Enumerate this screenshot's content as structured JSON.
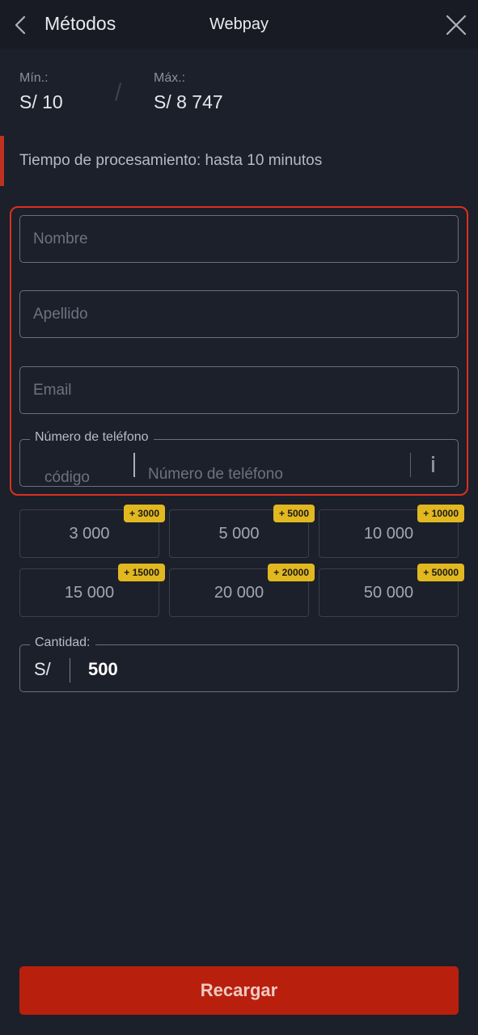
{
  "header": {
    "back_label": "Métodos",
    "title": "Webpay"
  },
  "limits": {
    "min_label": "Mín.:",
    "min_value": "S/ 10",
    "separator": "/",
    "max_label": "Máx.:",
    "max_value": "S/ 8 747"
  },
  "processing_text": "Tiempo de procesamiento: hasta 10 minutos",
  "form": {
    "first_name_placeholder": "Nombre",
    "last_name_placeholder": "Apellido",
    "email_placeholder": "Email",
    "phone_legend": "Número de teléfono",
    "phone_code_placeholder": "código",
    "phone_number_placeholder": "Número de teléfono"
  },
  "amount_options": [
    {
      "label": "3 000",
      "bonus": "+ 3000"
    },
    {
      "label": "5 000",
      "bonus": "+ 5000"
    },
    {
      "label": "10 000",
      "bonus": "+ 10000"
    },
    {
      "label": "15 000",
      "bonus": "+ 15000"
    },
    {
      "label": "20 000",
      "bonus": "+ 20000"
    },
    {
      "label": "50 000",
      "bonus": "+ 50000"
    }
  ],
  "cantidad": {
    "legend": "Cantidad:",
    "currency": "S/",
    "value": "500"
  },
  "submit_label": "Recargar",
  "colors": {
    "background": "#1c202b",
    "accent_red": "#b8200d",
    "highlight_border": "#d8321e",
    "bonus_badge": "#e2b820"
  }
}
